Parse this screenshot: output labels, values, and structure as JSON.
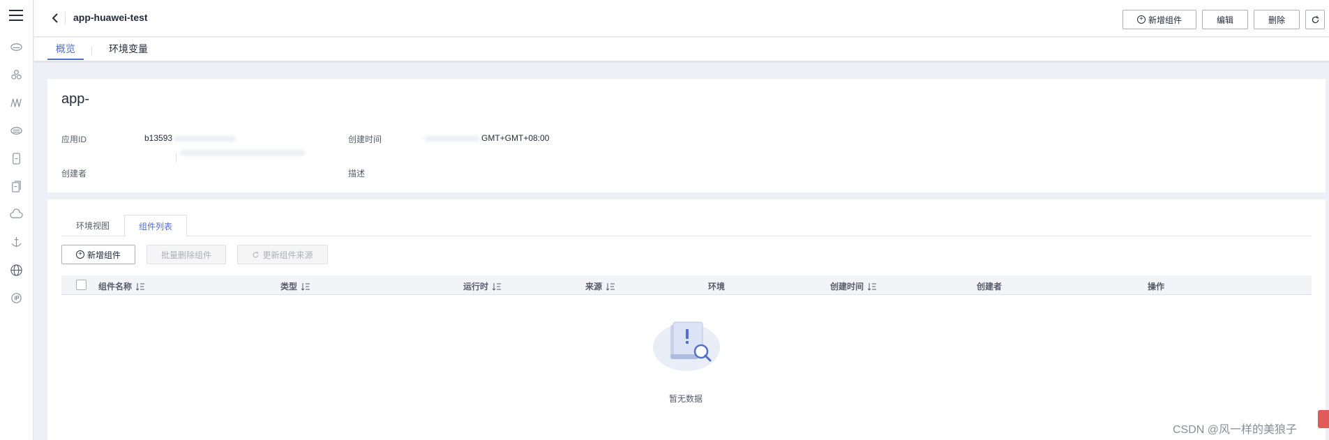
{
  "header": {
    "app_title": "app-huawei-test",
    "add_component": "新增组件",
    "edit": "编辑",
    "delete": "删除"
  },
  "tabs": [
    "概览",
    "环境变量"
  ],
  "info": {
    "app_name": "app-",
    "app_id_label": "应用ID",
    "app_id_value": "b13593",
    "created_time_label": "创建时间",
    "created_time_value": "GMT+GMT+08:00",
    "creator_label": "创建者",
    "desc_label": "描述"
  },
  "list": {
    "tabs": [
      "环境视图",
      "组件列表"
    ],
    "add_component": "新增组件",
    "batch_delete": "批量删除组件",
    "update_source": "更新组件来源",
    "columns": [
      "组件名称",
      "类型",
      "运行时",
      "来源",
      "环境",
      "创建时间",
      "创建者",
      "操作"
    ],
    "empty_text": "暂无数据"
  },
  "watermark": "CSDN @风一样的美狼子",
  "icons": {
    "menu": "hamburger-icon",
    "back": "chevron-left-icon",
    "add": "plus-circle-icon",
    "refresh": "refresh-icon",
    "sort": "sort-icon",
    "empty": "empty-document-search-icon"
  },
  "colors": {
    "accent": "#526ecc",
    "text": "#252b3a",
    "muted": "#575d6c",
    "bg": "#eef0f5"
  }
}
